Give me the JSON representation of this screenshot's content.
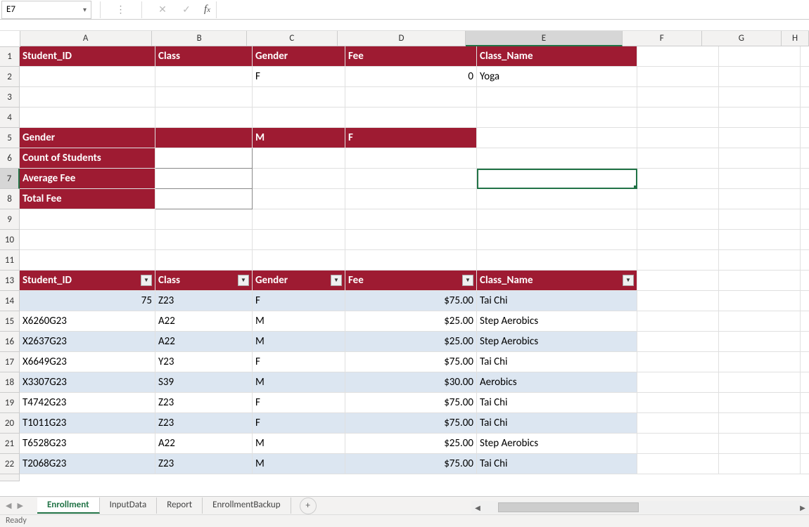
{
  "active_cell": "E7",
  "formula_value": "",
  "column_widths": {
    "A": 193,
    "B": 138,
    "C": 132,
    "D": 187,
    "E": 228,
    "F": 116,
    "G": 116,
    "H": 40
  },
  "columns": [
    "A",
    "B",
    "C",
    "D",
    "E",
    "F",
    "G",
    "H"
  ],
  "selected_column": "E",
  "row_numbers": [
    1,
    2,
    3,
    4,
    5,
    6,
    7,
    8,
    9,
    10,
    11,
    13,
    14,
    15,
    16,
    17,
    18,
    19,
    20,
    21,
    22
  ],
  "selected_row": 7,
  "headers1": {
    "A": "Student_ID",
    "B": "Class",
    "C": "Gender",
    "D": "Fee",
    "E": "Class_Name"
  },
  "row2": {
    "C": "F",
    "D": "0",
    "E": "Yoga"
  },
  "row5": {
    "A": "Gender",
    "C": "M",
    "D": "F"
  },
  "row6": {
    "A": "Count of Students"
  },
  "row7": {
    "A": "Average Fee"
  },
  "row8": {
    "A": "Total Fee"
  },
  "table_headers": {
    "A": "Student_ID",
    "B": "Class",
    "C": "Gender",
    "D": "Fee",
    "E": "Class_Name"
  },
  "table_rows": [
    {
      "A": "75",
      "B": "Z23",
      "C": "F",
      "D": "$75.00",
      "E": "Tai Chi"
    },
    {
      "A": "X6260G23",
      "B": "A22",
      "C": "M",
      "D": "$25.00",
      "E": "Step Aerobics"
    },
    {
      "A": "X2637G23",
      "B": "A22",
      "C": "M",
      "D": "$25.00",
      "E": "Step Aerobics"
    },
    {
      "A": "X6649G23",
      "B": "Y23",
      "C": "F",
      "D": "$75.00",
      "E": "Tai Chi"
    },
    {
      "A": "X3307G23",
      "B": "S39",
      "C": "M",
      "D": "$30.00",
      "E": "Aerobics"
    },
    {
      "A": "T4742G23",
      "B": "Z23",
      "C": "F",
      "D": "$75.00",
      "E": "Tai Chi"
    },
    {
      "A": "T1011G23",
      "B": "Z23",
      "C": "F",
      "D": "$75.00",
      "E": "Tai Chi"
    },
    {
      "A": "T6528G23",
      "B": "A22",
      "C": "M",
      "D": "$25.00",
      "E": "Step Aerobics"
    },
    {
      "A": "T2068G23",
      "B": "Z23",
      "C": "M",
      "D": "$75.00",
      "E": "Tai Chi"
    }
  ],
  "sheet_tabs": [
    "Enrollment",
    "InputData",
    "Report",
    "EnrollmentBackup"
  ],
  "active_tab": "Enrollment",
  "status": "Ready",
  "colors": {
    "header_red": "#9e1b32",
    "stripe": "#dce6f1",
    "excel_green": "#217346"
  }
}
